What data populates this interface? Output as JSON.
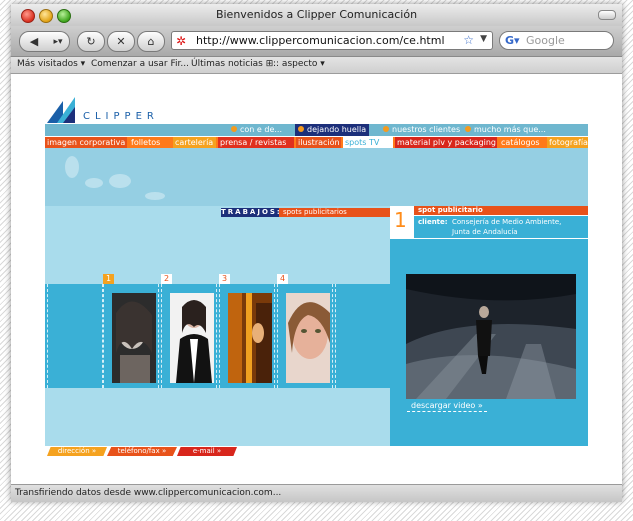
{
  "browser": {
    "title": "Bienvenidos a Clipper Comunicación",
    "url": "http://www.clippercomunicacion.com/ce.html",
    "search_placeholder": "Google",
    "bookmarks": [
      "Más visitados ▾",
      "Comenzar a usar Fir...",
      "Últimas noticias ⊞",
      ":: aspecto ▾"
    ],
    "status": "Transfiriendo datos desde www.clippercomunicacion.com..."
  },
  "site": {
    "logo_text": "CLIPPER",
    "top_nav": [
      {
        "label": "con e de..."
      },
      {
        "label": "dejando huella"
      },
      {
        "label": "nuestros clientes"
      },
      {
        "label": "mucho más que..."
      }
    ],
    "categories": [
      {
        "label": "imagen corporativa",
        "color": "#e8521a"
      },
      {
        "label": "folletos",
        "color": "#ff7a1a"
      },
      {
        "label": "cartelería",
        "color": "#f5a21f"
      },
      {
        "label": "prensa / revistas",
        "color": "#e0301e"
      },
      {
        "label": "ilustración",
        "color": "#e8521a"
      },
      {
        "label": "spots TV",
        "color": "#ffffff"
      },
      {
        "label": "material plv y packaging",
        "color": "#d8261c"
      },
      {
        "label": "catálogos",
        "color": "#ff7a1a"
      },
      {
        "label": "fotografía",
        "color": "#f5a21f"
      }
    ],
    "trabajos_label": "TRABAJOS:",
    "trabajos_value": "spots publicitarios",
    "thumbs": [
      "1",
      "2",
      "3",
      "4"
    ],
    "detail": {
      "number": "1",
      "title": "spot publicitario",
      "client_key": "cliente:",
      "client_line1": "Consejería de Medio Ambiente,",
      "client_line2": "Junta de Andalucía"
    },
    "download_label": "descargar video »",
    "footer": [
      "dirección »",
      "teléfono/fax »",
      "e-mail »"
    ]
  }
}
